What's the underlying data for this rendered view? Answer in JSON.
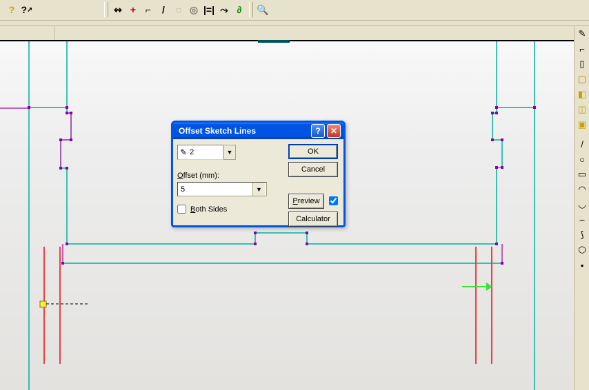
{
  "top_toolbar": {
    "help_qmark": "?",
    "context_help": "?",
    "tool_parallel": "↭",
    "tool_addpoint": "+",
    "tool_perp": "⌐",
    "tool_line": "/",
    "tool_circle1": "◌",
    "tool_circle2": "◎",
    "tool_offset": "|=|",
    "tool_tangent": "⤳",
    "tool_spline": "∂",
    "tool_zoom": "🔍"
  },
  "right_toolbar": {
    "rt_sketch": "✎",
    "rt_line": "⌐",
    "rt_rect": "▯",
    "rt_brect": "▢",
    "rt_extrude": "◧",
    "rt_revolve": "◫",
    "rt_box": "▣",
    "rt_line2": "/",
    "rt_circle": "○",
    "rt_rect2": "▭",
    "rt_arc1": "◠",
    "rt_arc2": "◡",
    "rt_arc3": "⌢",
    "rt_fillet": "⟆",
    "rt_pipe": "⬡",
    "rt_point": "•"
  },
  "dialog": {
    "title": "Offset Sketch Lines",
    "selection_count": "2",
    "offset_label_prefix": "O",
    "offset_label_rest": "ffset (mm):",
    "offset_value": "5",
    "both_sides_label_prefix": "B",
    "both_sides_label_rest": "oth Sides",
    "both_sides_checked": false,
    "ok_label": "OK",
    "cancel_label": "Cancel",
    "preview_label_prefix": "P",
    "preview_label_rest": "review",
    "preview_checked": true,
    "calculator_label": "Calculator"
  }
}
